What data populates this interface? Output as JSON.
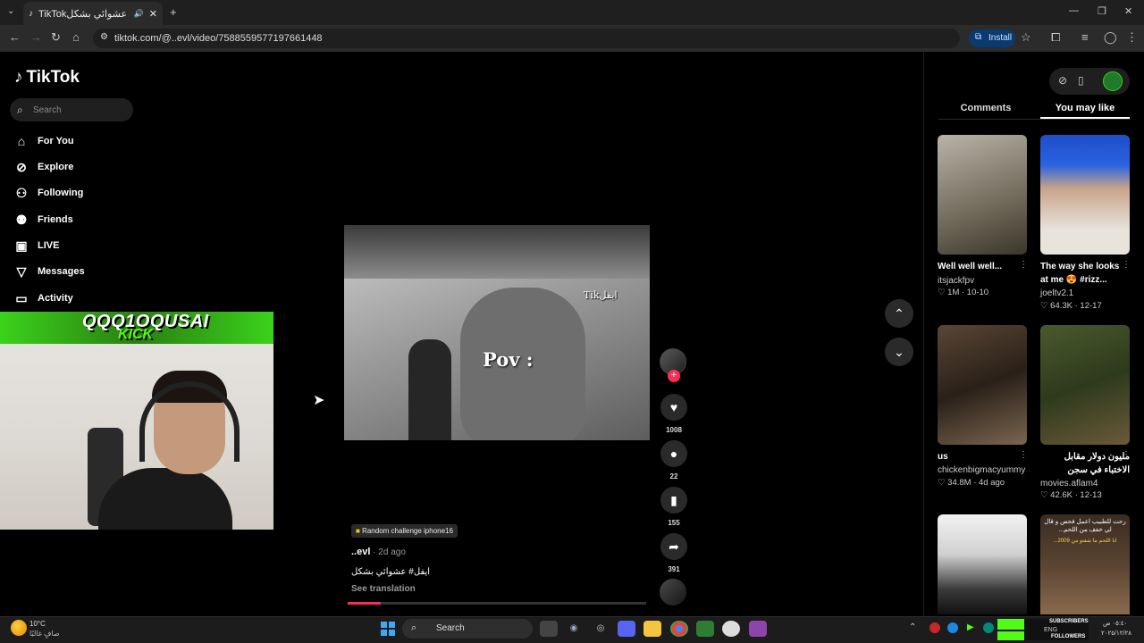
{
  "browser": {
    "tab_title": "TikTokايفل# عشوائي بشكل",
    "url": "tiktok.com/@..evl/video/7588559577197661448",
    "install_label": "Install"
  },
  "sidebar": {
    "logo": "TikTok",
    "search_placeholder": "Search",
    "items": [
      {
        "label": "For You",
        "icon": "home-icon"
      },
      {
        "label": "Explore",
        "icon": "compass-icon"
      },
      {
        "label": "Following",
        "icon": "person-icon"
      },
      {
        "label": "Friends",
        "icon": "friends-icon"
      },
      {
        "label": "LIVE",
        "icon": "live-icon"
      },
      {
        "label": "Messages",
        "icon": "send-icon"
      },
      {
        "label": "Activity",
        "icon": "activity-icon"
      }
    ]
  },
  "stream_overlay": {
    "name": "QQQ1OQUSAI",
    "platform": "KICK"
  },
  "video": {
    "overlay_text": "Pov :",
    "watermark": "Tikايفل",
    "challenge": "Random challenge iphone16",
    "author": "..evl",
    "time": " · 2d ago",
    "caption": "ايفل# عشوائي بشكل",
    "see_translation": "See translation",
    "progress": 0.11
  },
  "actions": {
    "likes": "1008",
    "comments": "22",
    "saves": "155",
    "shares": "391"
  },
  "right_panel": {
    "tab_comments": "Comments",
    "tab_you_may_like": "You may like",
    "cards": [
      {
        "title": "Well well well...",
        "user": "itsjackfpv",
        "stats": "♡ 1M · 10-10"
      },
      {
        "title": "The way she looks at me 😍 #rizz...",
        "user": "joeltv2.1",
        "stats": "♡ 64.3K · 12-17"
      },
      {
        "title": "us",
        "user": "chickenbigmacyummy",
        "stats": "♡ 34.8M · 4d ago"
      },
      {
        "title": "مليون دولار مقابل الاختباء في سجن مهجور...",
        "user": "movies.aflam4",
        "stats": "♡ 42.6K · 12-13"
      }
    ],
    "card6_text": "رحت للطبيب اعمل فحص و قال لي خفف من اللحم...",
    "card6_sub": "انا اللحم ما شفتو من 2009..."
  },
  "taskbar": {
    "temp": "10°C",
    "weather": "صافٍ غالبًا",
    "search": "Search",
    "subscribers_label": "SUBSCRIBERS",
    "followers_label": "FOLLOWERS",
    "lang": "ENG",
    "time": "٠٥:٤٠ ص",
    "date": "٢٠٢٥/١٢/٢٨"
  }
}
